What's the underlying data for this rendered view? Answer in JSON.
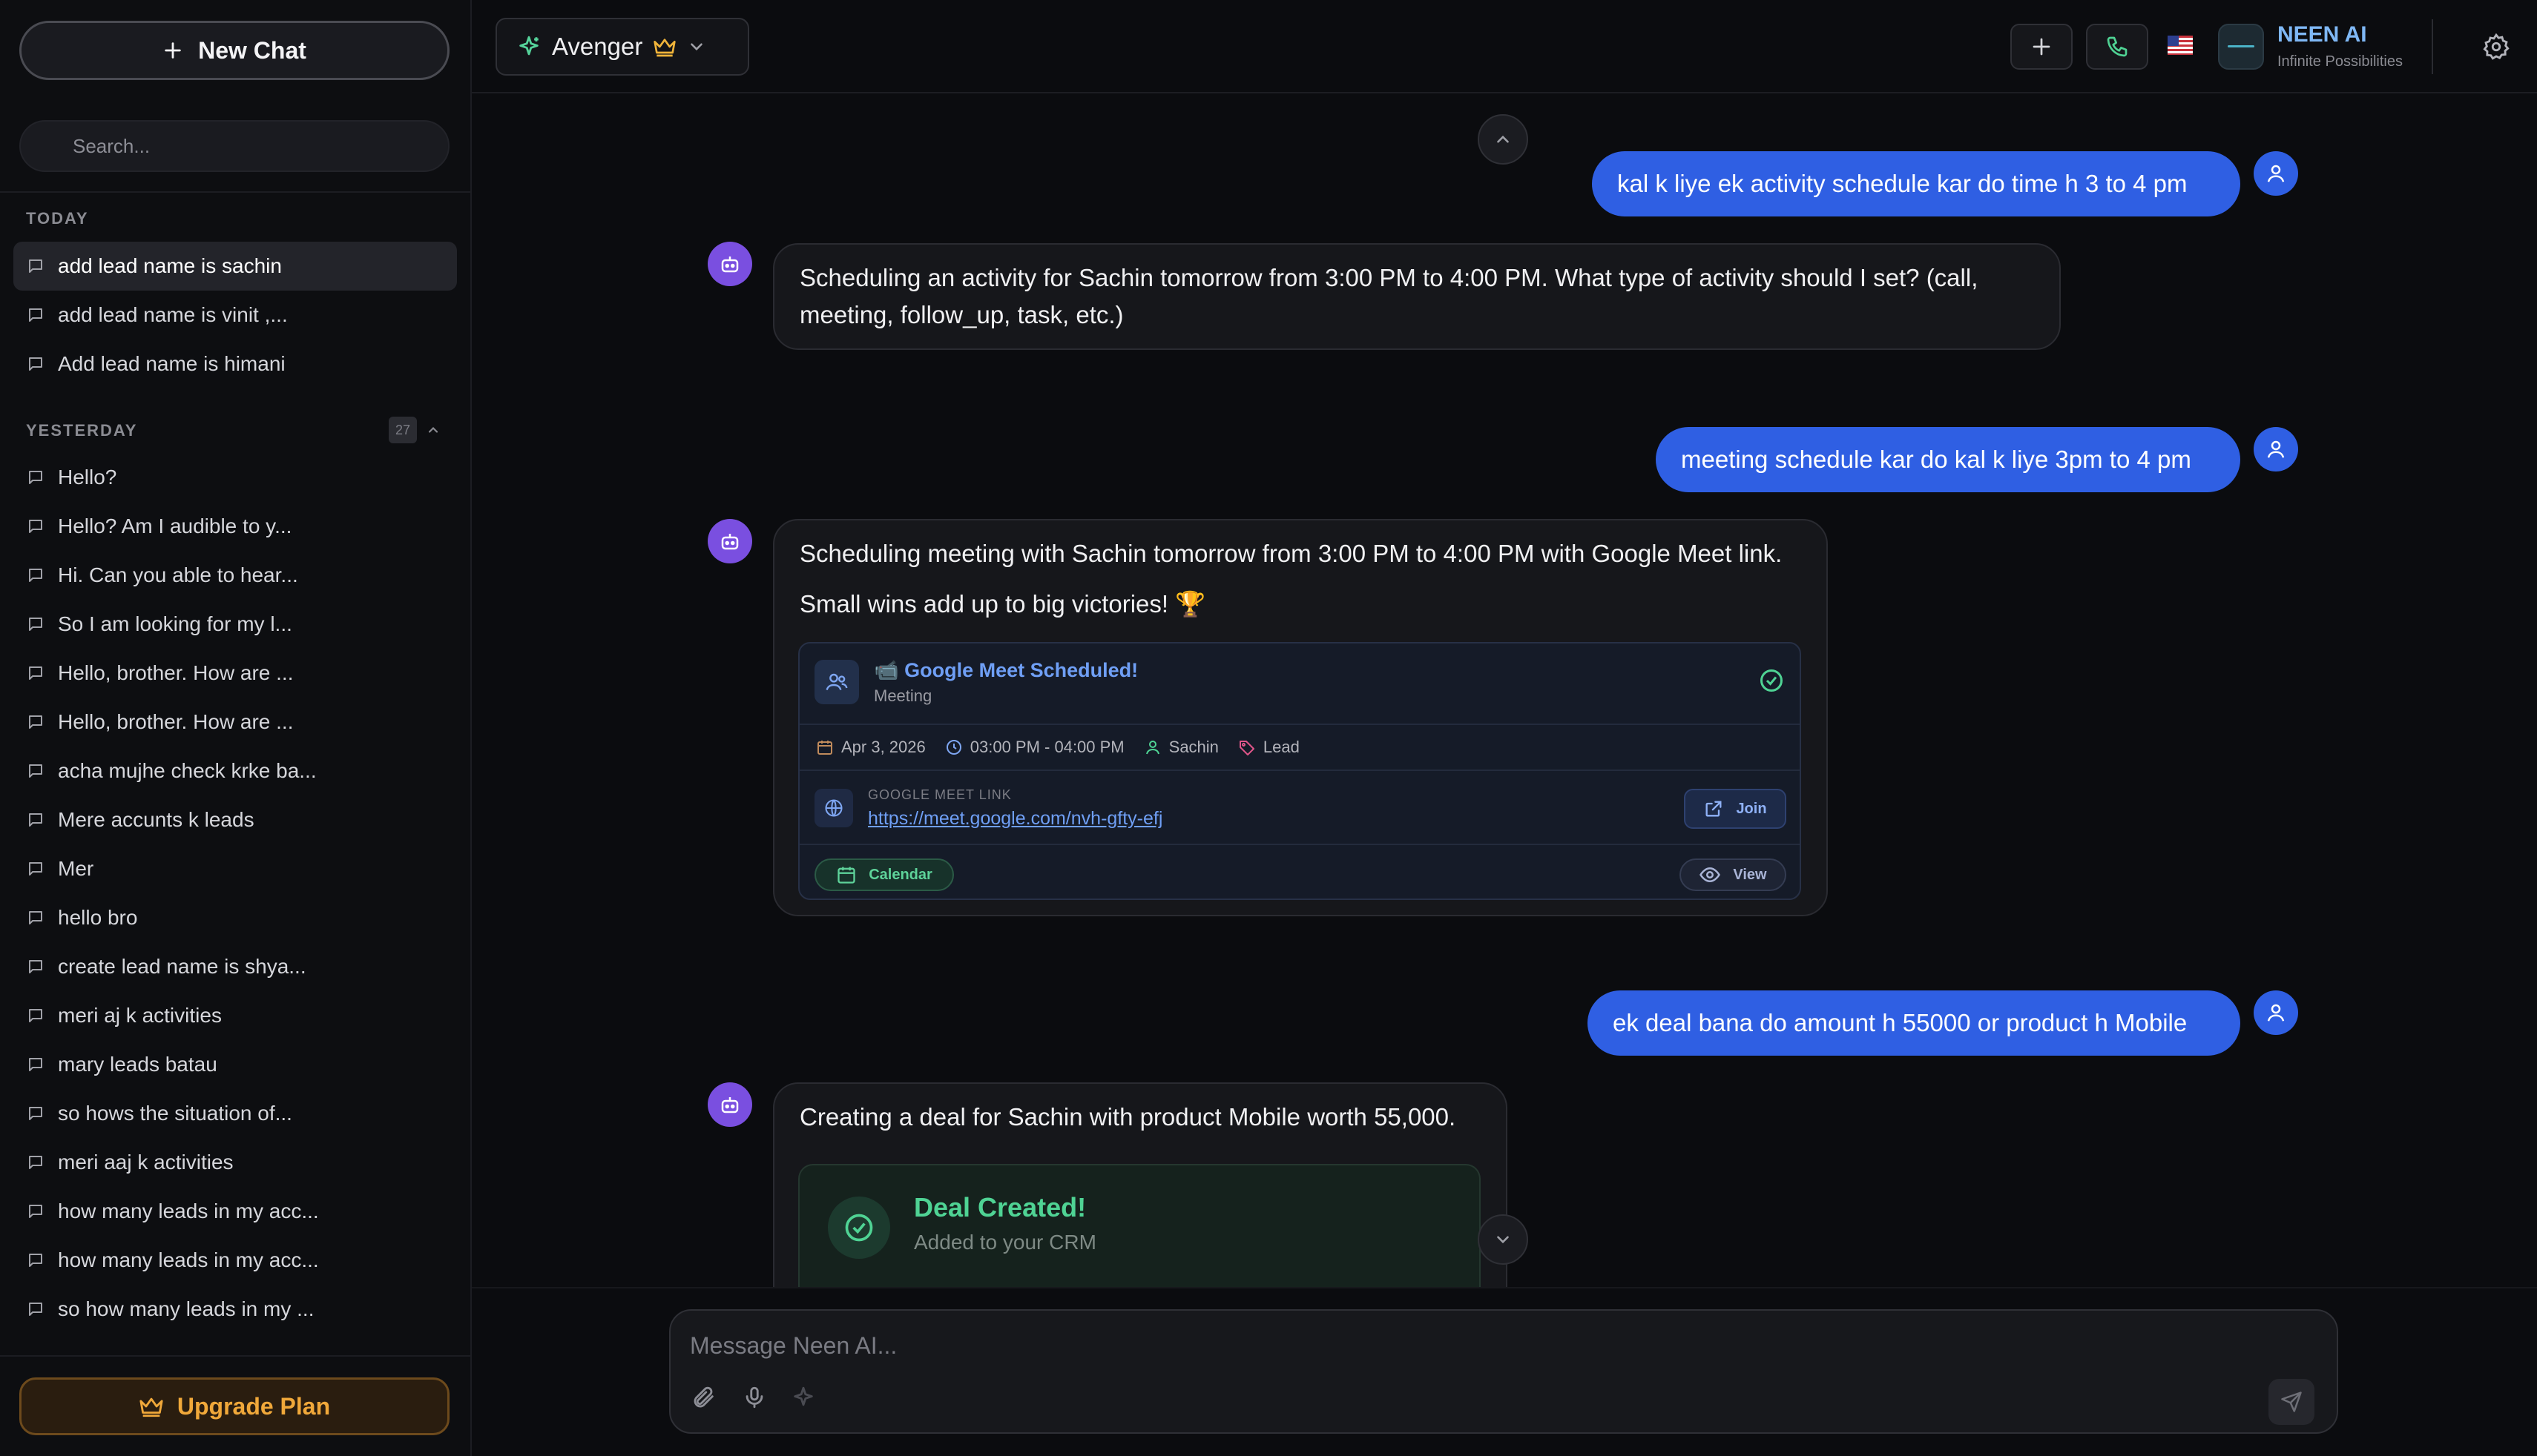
{
  "sidebar": {
    "new_chat_label": "New Chat",
    "search_placeholder": "Search...",
    "today_label": "TODAY",
    "yesterday_label": "YESTERDAY",
    "yesterday_count": "27",
    "today_items": [
      {
        "label": "add lead name is sachin",
        "active": true
      },
      {
        "label": "add lead name is vinit ,..."
      },
      {
        "label": "Add lead name is himani"
      }
    ],
    "yesterday_items": [
      {
        "label": "Hello?"
      },
      {
        "label": "Hello? Am I audible to y..."
      },
      {
        "label": "Hi. Can you able to hear..."
      },
      {
        "label": "So I am looking for my l..."
      },
      {
        "label": "Hello, brother. How are ..."
      },
      {
        "label": "Hello, brother. How are ..."
      },
      {
        "label": "acha mujhe check krke ba..."
      },
      {
        "label": "Mere accunts k leads"
      },
      {
        "label": "Mer"
      },
      {
        "label": "hello bro"
      },
      {
        "label": "create lead name is shya..."
      },
      {
        "label": "meri aj k activities"
      },
      {
        "label": "mary leads batau"
      },
      {
        "label": "so hows the situation of..."
      },
      {
        "label": "meri aaj k activities"
      },
      {
        "label": "how many leads in my acc..."
      },
      {
        "label": "how many leads in my acc..."
      },
      {
        "label": "so how many leads in my ..."
      }
    ],
    "upgrade_label": "Upgrade Plan"
  },
  "header": {
    "model_name": "Avenger",
    "brand_name": "NEEN AI",
    "brand_tagline": "Infinite Possibilities",
    "icons": [
      "sparkle-icon",
      "crown-icon",
      "chevron-down-icon",
      "plus-icon",
      "phone-icon",
      "us-flag-icon",
      "settings-icon"
    ]
  },
  "messages": [
    {
      "role": "user",
      "text": "kal k liye ek activity schedule kar do time h  3 to 4 pm"
    },
    {
      "role": "assistant",
      "lines": [
        "Scheduling an activity for Sachin tomorrow from 3:00 PM to 4:00 PM. What type of activity should I set? (call,",
        "meeting, follow_up, task, etc.)"
      ]
    },
    {
      "role": "user",
      "text": "meeting schedule kar do kal k liye 3pm to 4 pm"
    },
    {
      "role": "assistant",
      "lines": [
        "Scheduling meeting with Sachin tomorrow from 3:00 PM to 4:00 PM with Google Meet link.",
        "Small wins add up to big victories! 🏆"
      ]
    },
    {
      "role": "user",
      "text": "ek deal bana do amount h 55000 or product h Mobile"
    },
    {
      "role": "assistant",
      "lines": [
        "Creating a deal for Sachin with product Mobile worth 55,000."
      ]
    }
  ],
  "meeting_card": {
    "title": "📹 Google Meet Scheduled!",
    "subtitle": "Meeting",
    "date": "Apr 3, 2026",
    "time": "03:00 PM - 04:00 PM",
    "person": "Sachin",
    "tag": "Lead",
    "link_label": "GOOGLE MEET LINK",
    "link_url": "https://meet.google.com/nvh-gfty-efj",
    "join_label": "Join",
    "calendar_label": "Calendar",
    "view_label": "View"
  },
  "deal_card": {
    "title": "Deal Created!",
    "subtitle": "Added to your CRM"
  },
  "composer": {
    "placeholder": "Message Neen AI..."
  },
  "colors": {
    "accent_blue": "#2f5fe3",
    "bot_purple": "#7a4fe0",
    "upgrade_orange": "#f0a83a",
    "success_green": "#4fd394"
  }
}
